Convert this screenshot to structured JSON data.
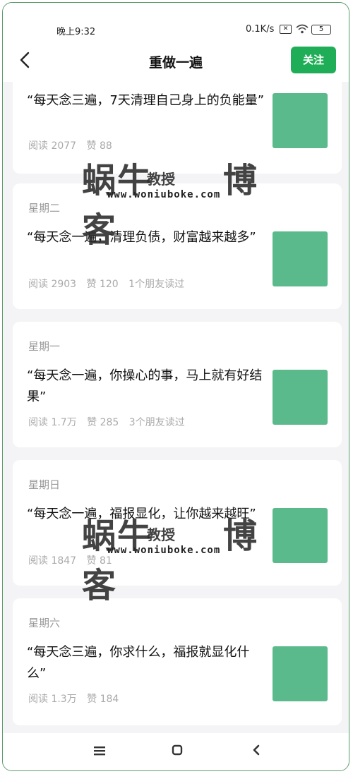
{
  "status": {
    "time": "晚上9:32",
    "net": "0.1K/s",
    "battery": "5"
  },
  "header": {
    "title": "重做一遍",
    "follow_label": "关注"
  },
  "articles": [
    {
      "weekday": "",
      "title": "“每天念三遍，7天清理自己身上的负能量”",
      "reads": "阅读 2077",
      "likes": "赞 88",
      "friends": ""
    },
    {
      "weekday": "星期二",
      "title": "“每天念一遍，清理负债，财富越来越多”",
      "reads": "阅读 2903",
      "likes": "赞 120",
      "friends": "1个朋友读过"
    },
    {
      "weekday": "星期一",
      "title": "“每天念一遍，你操心的事，马上就有好结果”",
      "reads": "阅读 1.7万",
      "likes": "赞 285",
      "friends": "3个朋友读过"
    },
    {
      "weekday": "星期日",
      "title": "“每天念一遍，福报显化，让你越来越旺”",
      "reads": "阅读 1847",
      "likes": "赞 81",
      "friends": ""
    },
    {
      "weekday": "星期六",
      "title": "“每天念三遍，你求什么，福报就显化什么”",
      "reads": "阅读 1.3万",
      "likes": "赞 184",
      "friends": ""
    }
  ],
  "watermark": {
    "logo": "蜗牛",
    "small": "教授",
    "blog": "博客",
    "url": "www.woniuboke.com"
  },
  "icons": {
    "back": "chevron-left-icon",
    "menu": "menu-icon",
    "home": "home-square-icon",
    "nav_back": "nav-back-icon"
  },
  "colors": {
    "accent": "#1fae57",
    "thumb": "#5bba8b"
  }
}
